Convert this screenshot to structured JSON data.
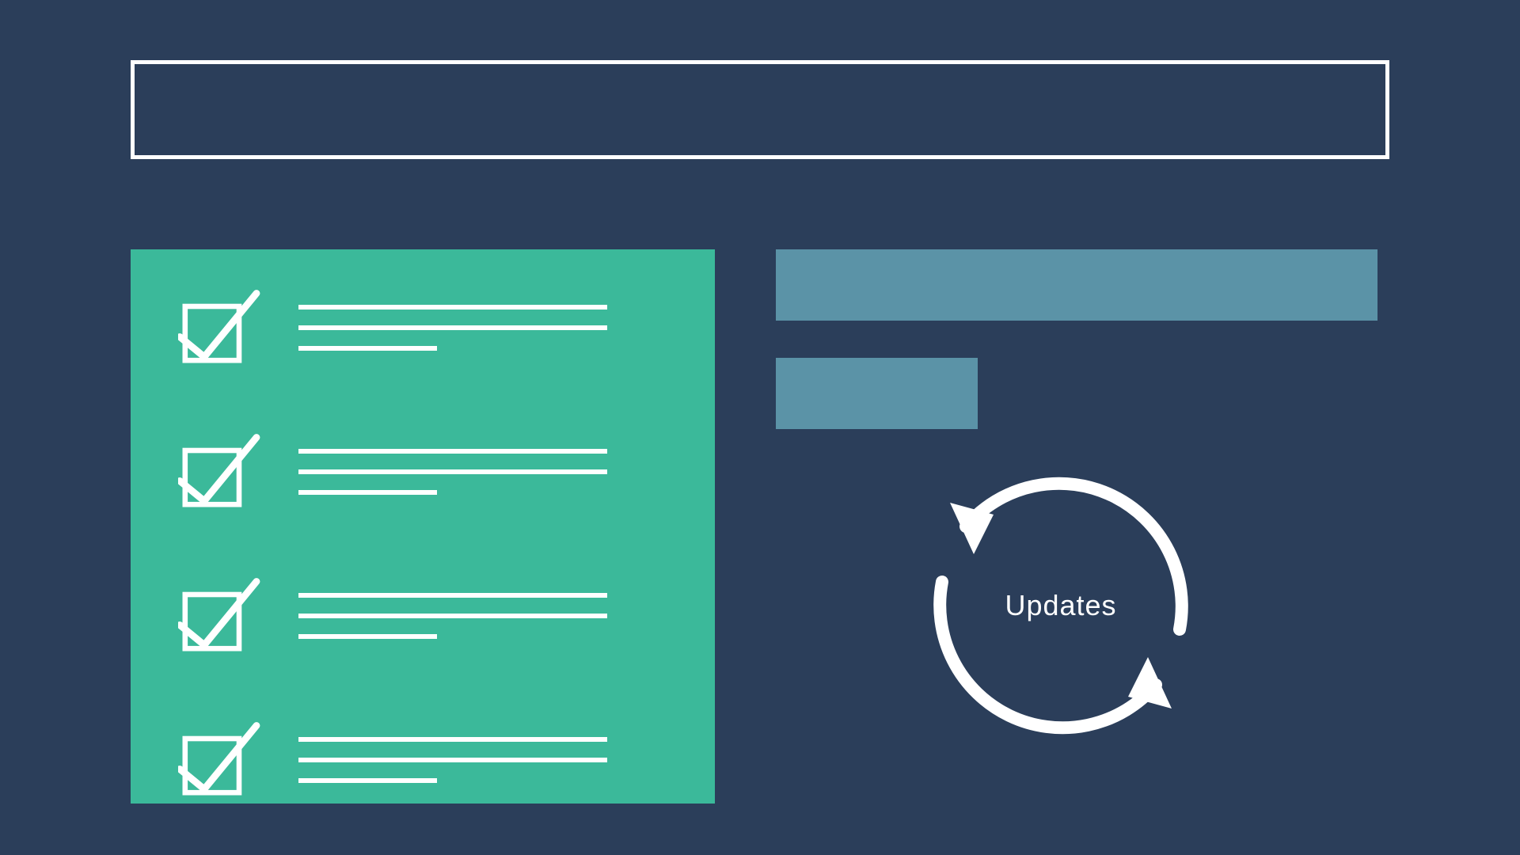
{
  "colors": {
    "background": "#2b3e5a",
    "panel": "#3bb99a",
    "bar": "#5b93a7",
    "stroke": "#ffffff"
  },
  "header": {
    "title": ""
  },
  "checklist": {
    "items": [
      {
        "checked": true
      },
      {
        "checked": true
      },
      {
        "checked": true
      },
      {
        "checked": true
      }
    ]
  },
  "bars": [
    {
      "width_ratio": 1.0
    },
    {
      "width_ratio": 0.335
    }
  ],
  "cycle": {
    "label": "Updates"
  }
}
